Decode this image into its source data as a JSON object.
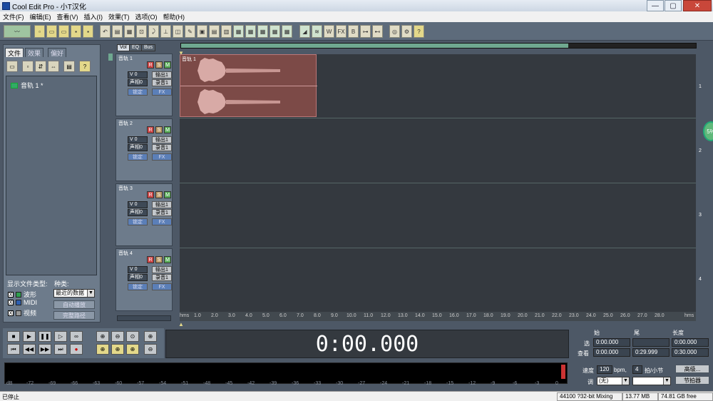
{
  "window": {
    "title": "Cool Edit Pro  - 小T汉化",
    "min": "—",
    "max": "▢",
    "close": "✕"
  },
  "menu": [
    "文件(F)",
    "编辑(E)",
    "查看(V)",
    "插入(I)",
    "效果(T)",
    "选项(O)",
    "帮助(H)"
  ],
  "left_panel": {
    "tabs": [
      "文件",
      "效果",
      "偏好"
    ],
    "file_item": "音轨  1 *",
    "show_types_label": "显示文件类型:",
    "kind_label": "种类:",
    "types": [
      {
        "check": "X",
        "label": "波形",
        "color": "#2f9e4f"
      },
      {
        "check": "X",
        "label": "MIDI",
        "color": "#2e5fb0"
      },
      {
        "check": "X",
        "label": "视频",
        "color": "#9a9a9a"
      }
    ],
    "kind_select": "最近的数据",
    "btn_autoplay": "自动播放",
    "btn_fullpath": "完整路径"
  },
  "track_tabs": [
    "Vol",
    "EQ",
    "Bus"
  ],
  "tracks": [
    {
      "name": "音轨 1",
      "vol": "V 0",
      "pan": "声相0",
      "out": "输出1",
      "rec": "录音1",
      "lock": "锁定",
      "fx": "FX",
      "r": "R",
      "s": "S",
      "m": "M",
      "lane": "1"
    },
    {
      "name": "音轨 2",
      "vol": "V 0",
      "pan": "声相0",
      "out": "输出1",
      "rec": "录音1",
      "lock": "锁定",
      "fx": "FX",
      "r": "R",
      "s": "S",
      "m": "M",
      "lane": "2"
    },
    {
      "name": "音轨 3",
      "vol": "V 0",
      "pan": "声相0",
      "out": "输出1",
      "rec": "录音1",
      "lock": "锁定",
      "fx": "FX",
      "r": "R",
      "s": "S",
      "m": "M",
      "lane": "3"
    },
    {
      "name": "音轨 4",
      "vol": "V 0",
      "pan": "声相0",
      "out": "输出1",
      "rec": "录音1",
      "lock": "锁定",
      "fx": "FX",
      "r": "R",
      "s": "S",
      "m": "M",
      "lane": "4"
    }
  ],
  "clip_label": "音轨  1",
  "ruler": [
    "hms",
    "1.0",
    "2.0",
    "3.0",
    "4.0",
    "5.0",
    "6.0",
    "7.0",
    "8.0",
    "9.0",
    "10.0",
    "11.0",
    "12.0",
    "13.0",
    "14.0",
    "15.0",
    "16.0",
    "17.0",
    "18.0",
    "19.0",
    "20.0",
    "21.0",
    "22.0",
    "23.0",
    "24.0",
    "25.0",
    "26.0",
    "27.0",
    "28.0",
    "hms"
  ],
  "time_display": "0:00.000",
  "selection": {
    "start_label": "始",
    "end_label": "尾",
    "length_label": "长度",
    "sel_label": "选",
    "view_label": "查看",
    "sel_start": "0:00.000",
    "sel_end": "",
    "sel_length": "0:00.000",
    "view_start": "0:00.000",
    "view_end": "0:29.999",
    "view_length": "0:30.000"
  },
  "tempo": {
    "speed_label": "速度",
    "bpm": "120",
    "bpm_unit": "bpm,",
    "beats": "4",
    "beats_label": "拍/小节",
    "key_label": "调",
    "key_value": "(无)",
    "btn_advanced": "高级...",
    "btn_metronome": "节拍器"
  },
  "level_scale": [
    "dB",
    "-72",
    "-69",
    "-66",
    "-63",
    "-60",
    "-57",
    "-54",
    "-51",
    "-48",
    "-45",
    "-42",
    "-39",
    "-36",
    "-33",
    "-30",
    "-27",
    "-24",
    "-21",
    "-18",
    "-15",
    "-12",
    "-9",
    "-6",
    "-3",
    "0"
  ],
  "status": {
    "left": "已停止",
    "format": "44100 ?32-bit Mixing",
    "size": "13.77 MB",
    "free": "74.81 GB free"
  },
  "knob": "5%",
  "colors": {
    "clip": "#7c4a47",
    "overview": "#6fa890",
    "accent_green": "#5fb87a"
  }
}
